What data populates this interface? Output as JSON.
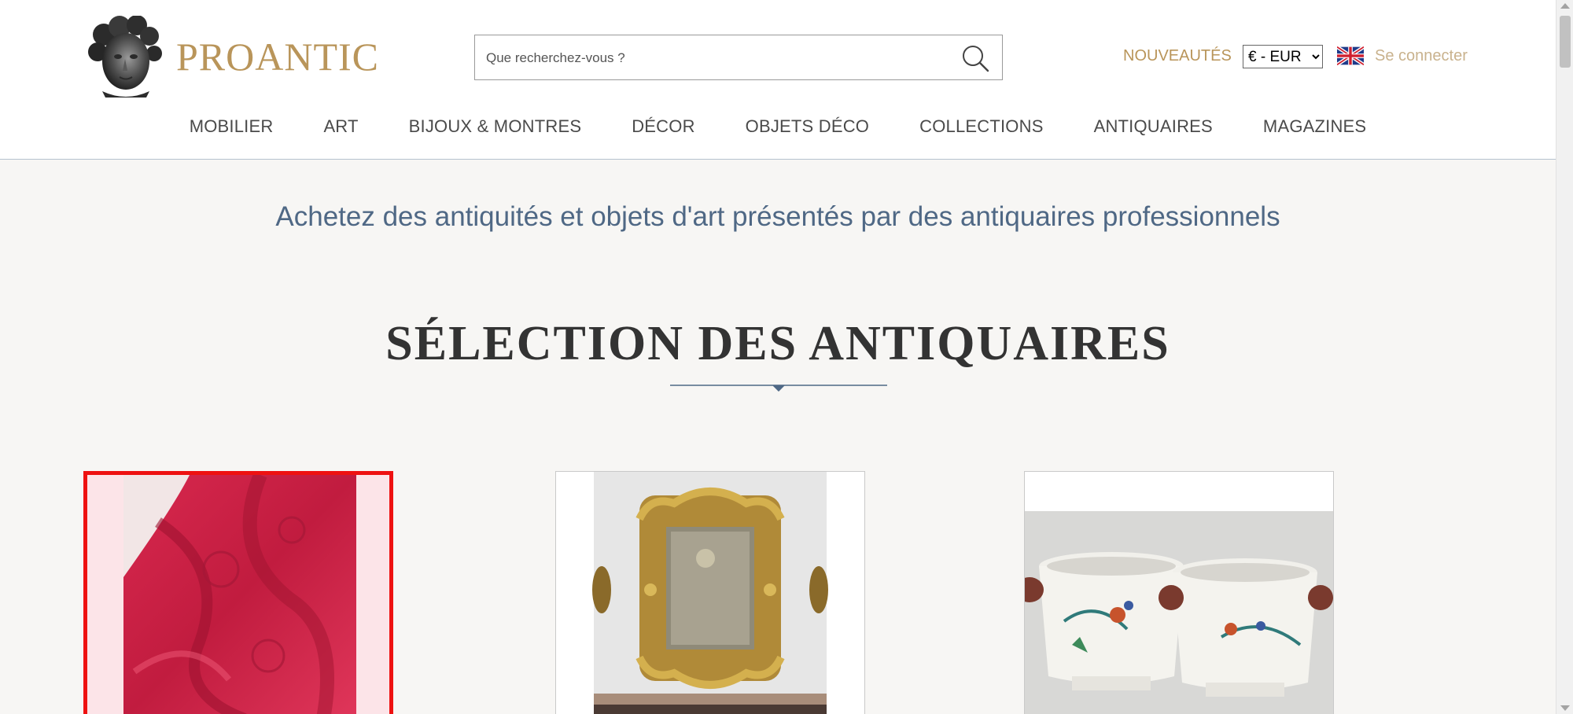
{
  "header": {
    "logo_text": "PROANTIC",
    "search_placeholder": "Que recherchez-vous ?",
    "new_label": "NOUVEAUTÉS",
    "currency_selected": "€ - EUR",
    "login_label": "Se connecter"
  },
  "nav": {
    "items": [
      {
        "label": "MOBILIER"
      },
      {
        "label": "ART"
      },
      {
        "label": "BIJOUX & MONTRES"
      },
      {
        "label": "DÉCOR"
      },
      {
        "label": "OBJETS DÉCO"
      },
      {
        "label": "COLLECTIONS"
      },
      {
        "label": "ANTIQUAIRES"
      },
      {
        "label": "MAGAZINES"
      }
    ]
  },
  "main": {
    "tagline": "Achetez des antiquités et objets d'art présentés par des antiquaires professionnels",
    "section_title": "SÉLECTION DES ANTIQUAIRES"
  },
  "colors": {
    "gold": "#b9955a",
    "tagline_blue": "#4f6885",
    "selected_border": "#ee1111",
    "page_bg": "#f7f6f4"
  },
  "icons": {
    "logo": "cherub-head-icon",
    "search": "search-icon",
    "flag": "uk-flag-icon"
  }
}
